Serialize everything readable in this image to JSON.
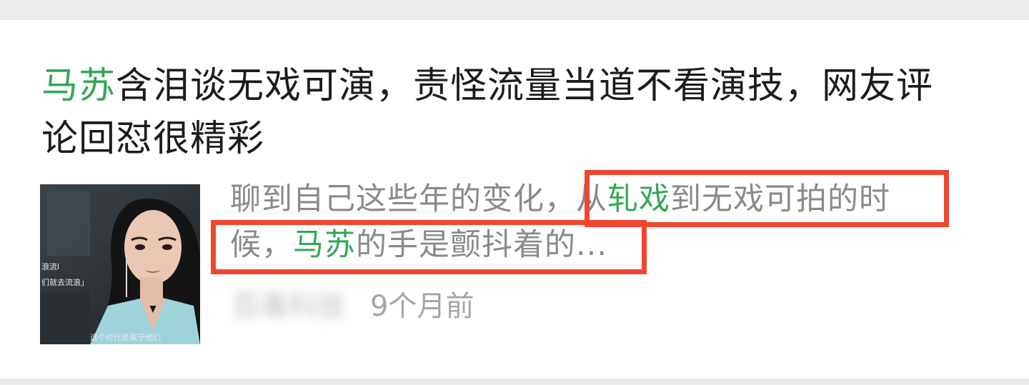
{
  "article": {
    "title_highlight": "马苏",
    "title_rest": "含泪谈无戏可演，责怪流量当道不看演技，网友评论回怼很精彩",
    "snippet_pre": "聊到自己这些年的变化，从",
    "snippet_hl1": "轧戏",
    "snippet_mid": "到无戏可拍的时候，",
    "snippet_hl2": "马苏",
    "snippet_post": "的手是颤抖着的...",
    "source": "百毒科技",
    "time": "9个月前"
  },
  "thumbnail": {
    "caption_lines": [
      "浪流l",
      "们就去流浪」"
    ],
    "subtitle": "这个时代是属于他们"
  },
  "colors": {
    "highlight": "#33a853",
    "annotation_box": "#f0462e"
  }
}
